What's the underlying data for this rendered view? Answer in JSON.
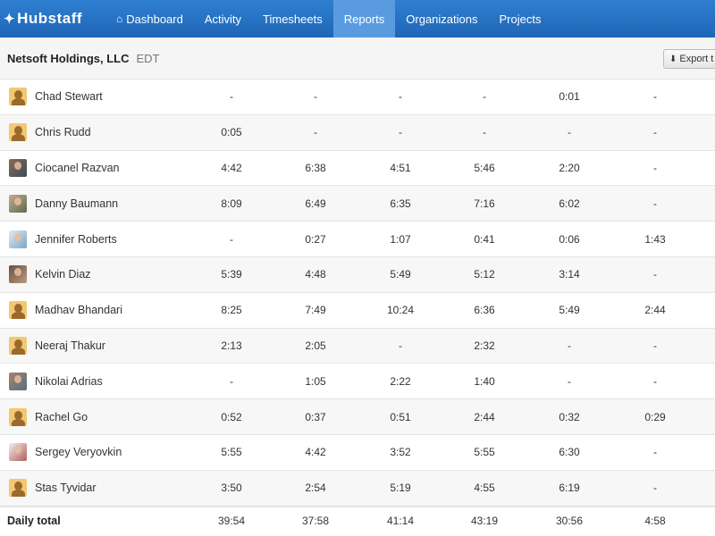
{
  "navbar": {
    "brand": "Hubstaff",
    "items": [
      {
        "label": "Dashboard",
        "active": false
      },
      {
        "label": "Activity",
        "active": false
      },
      {
        "label": "Timesheets",
        "active": false
      },
      {
        "label": "Reports",
        "active": true
      },
      {
        "label": "Organizations",
        "active": false
      },
      {
        "label": "Projects",
        "active": false
      }
    ]
  },
  "organization": {
    "name": "Netsoft Holdings, LLC",
    "timezone": "EDT",
    "export_label": "Export t"
  },
  "rows": [
    {
      "name": "Chad Stewart",
      "avatar": "default",
      "values": [
        "-",
        "-",
        "-",
        "-",
        "0:01",
        "-"
      ]
    },
    {
      "name": "Chris Rudd",
      "avatar": "default",
      "values": [
        "0:05",
        "-",
        "-",
        "-",
        "-",
        "-"
      ]
    },
    {
      "name": "Ciocanel Razvan",
      "avatar": "photo",
      "values": [
        "4:42",
        "6:38",
        "4:51",
        "5:46",
        "2:20",
        "-"
      ]
    },
    {
      "name": "Danny Baumann",
      "avatar": "photo",
      "values": [
        "8:09",
        "6:49",
        "6:35",
        "7:16",
        "6:02",
        "-"
      ]
    },
    {
      "name": "Jennifer Roberts",
      "avatar": "photo",
      "values": [
        "-",
        "0:27",
        "1:07",
        "0:41",
        "0:06",
        "1:43"
      ]
    },
    {
      "name": "Kelvin Diaz",
      "avatar": "photo",
      "values": [
        "5:39",
        "4:48",
        "5:49",
        "5:12",
        "3:14",
        "-"
      ]
    },
    {
      "name": "Madhav Bhandari",
      "avatar": "default",
      "values": [
        "8:25",
        "7:49",
        "10:24",
        "6:36",
        "5:49",
        "2:44"
      ]
    },
    {
      "name": "Neeraj Thakur",
      "avatar": "default",
      "values": [
        "2:13",
        "2:05",
        "-",
        "2:32",
        "-",
        "-"
      ]
    },
    {
      "name": "Nikolai Adrias",
      "avatar": "photo",
      "values": [
        "-",
        "1:05",
        "2:22",
        "1:40",
        "-",
        "-"
      ]
    },
    {
      "name": "Rachel Go",
      "avatar": "default",
      "values": [
        "0:52",
        "0:37",
        "0:51",
        "2:44",
        "0:32",
        "0:29"
      ]
    },
    {
      "name": "Sergey Veryovkin",
      "avatar": "photo",
      "values": [
        "5:55",
        "4:42",
        "3:52",
        "5:55",
        "6:30",
        "-"
      ]
    },
    {
      "name": "Stas Tyvidar",
      "avatar": "default",
      "values": [
        "3:50",
        "2:54",
        "5:19",
        "4:55",
        "6:19",
        "-"
      ]
    }
  ],
  "daily_total": {
    "label": "Daily total",
    "values": [
      "39:54",
      "37:58",
      "41:14",
      "43:19",
      "30:56",
      "4:58"
    ]
  }
}
